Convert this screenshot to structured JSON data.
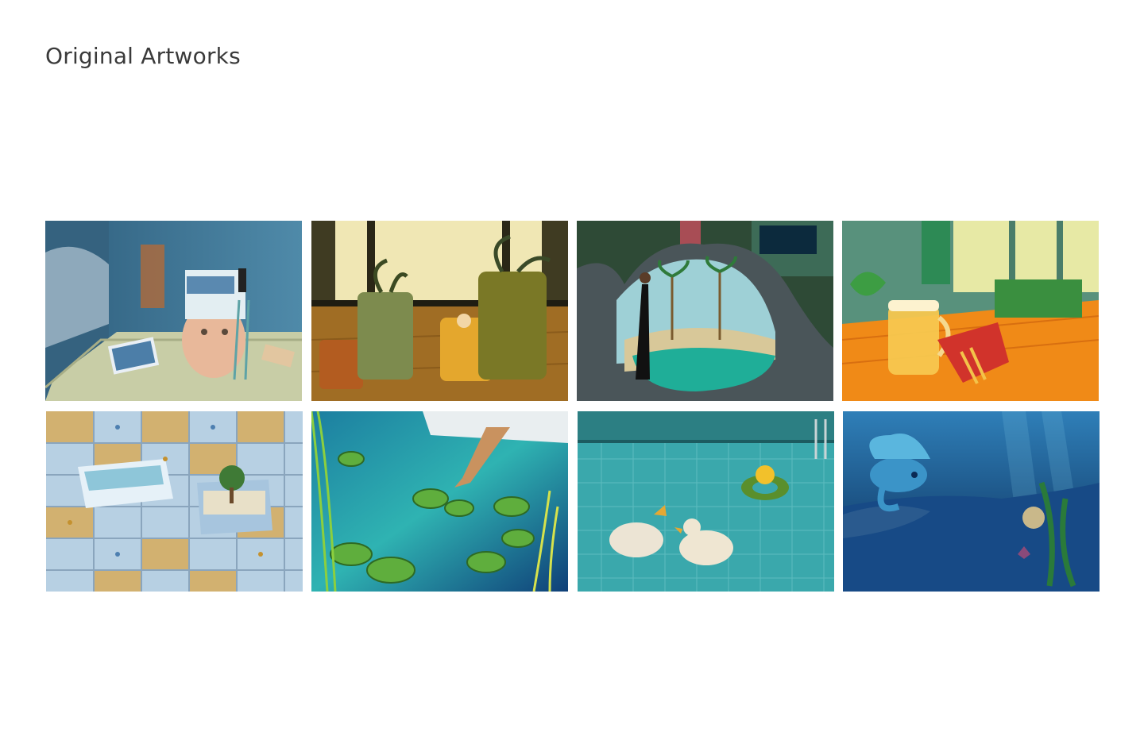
{
  "header": {
    "title": "Original Artworks"
  },
  "gallery": {
    "artworks": [
      {
        "subject": "head-on-desk-with-ladder",
        "palette": [
          "#3e6f8e",
          "#c9cfa6",
          "#e9b89b"
        ]
      },
      {
        "subject": "potted-plants-room",
        "palette": [
          "#5b5a2a",
          "#8da05a",
          "#e3a62b"
        ]
      },
      {
        "subject": "woman-lifting-blanket-beach",
        "palette": [
          "#2e4d3c",
          "#1fae98",
          "#d7c89a"
        ]
      },
      {
        "subject": "beer-mug-and-fries",
        "palette": [
          "#4f8d79",
          "#f29d1f",
          "#d13b2b"
        ]
      },
      {
        "subject": "drawer-cabinet-wall",
        "palette": [
          "#a9c6df",
          "#d8b57a",
          "#6f8fa8"
        ]
      },
      {
        "subject": "lily-pond-feet",
        "palette": [
          "#1e6c9c",
          "#2bb3b0",
          "#6ca73d"
        ]
      },
      {
        "subject": "ducks-in-pool",
        "palette": [
          "#34a5aa",
          "#7ad0cc",
          "#f3e8d0"
        ]
      },
      {
        "subject": "betta-fish-underwater",
        "palette": [
          "#0e3d6e",
          "#2a80b8",
          "#5cc1da"
        ]
      }
    ]
  }
}
